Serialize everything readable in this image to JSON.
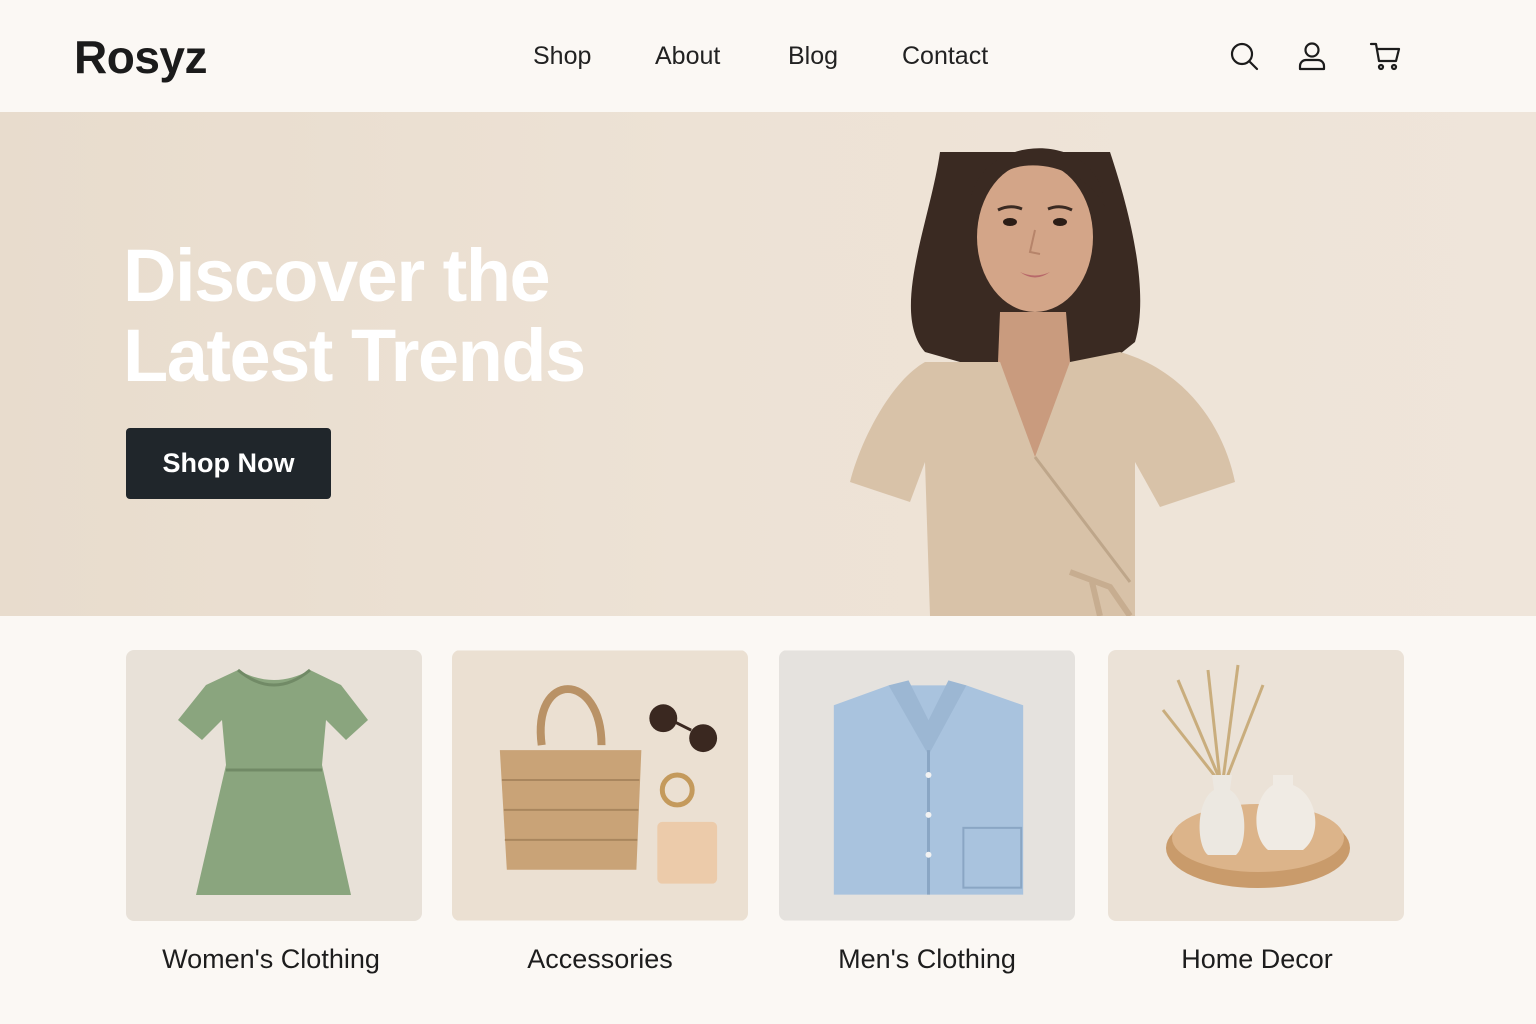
{
  "brand": {
    "name": "Rosyz"
  },
  "nav": {
    "items": [
      {
        "label": "Shop"
      },
      {
        "label": "About"
      },
      {
        "label": "Blog"
      },
      {
        "label": "Contact"
      }
    ]
  },
  "header_icons": [
    "search-icon",
    "user-icon",
    "cart-icon"
  ],
  "hero": {
    "title_line1": "Discover the",
    "title_line2": "Latest Trends",
    "cta_label": "Shop Now"
  },
  "categories": [
    {
      "label": "Women's Clothing"
    },
    {
      "label": "Accessories"
    },
    {
      "label": "Men's Clothing"
    },
    {
      "label": "Home Decor"
    }
  ],
  "colors": {
    "page_bg": "#fbf8f4",
    "hero_bg": "#ede2d5",
    "cta_bg": "#20262b",
    "dress_green": "#8aa57e",
    "denim_blue": "#a9c3de"
  }
}
